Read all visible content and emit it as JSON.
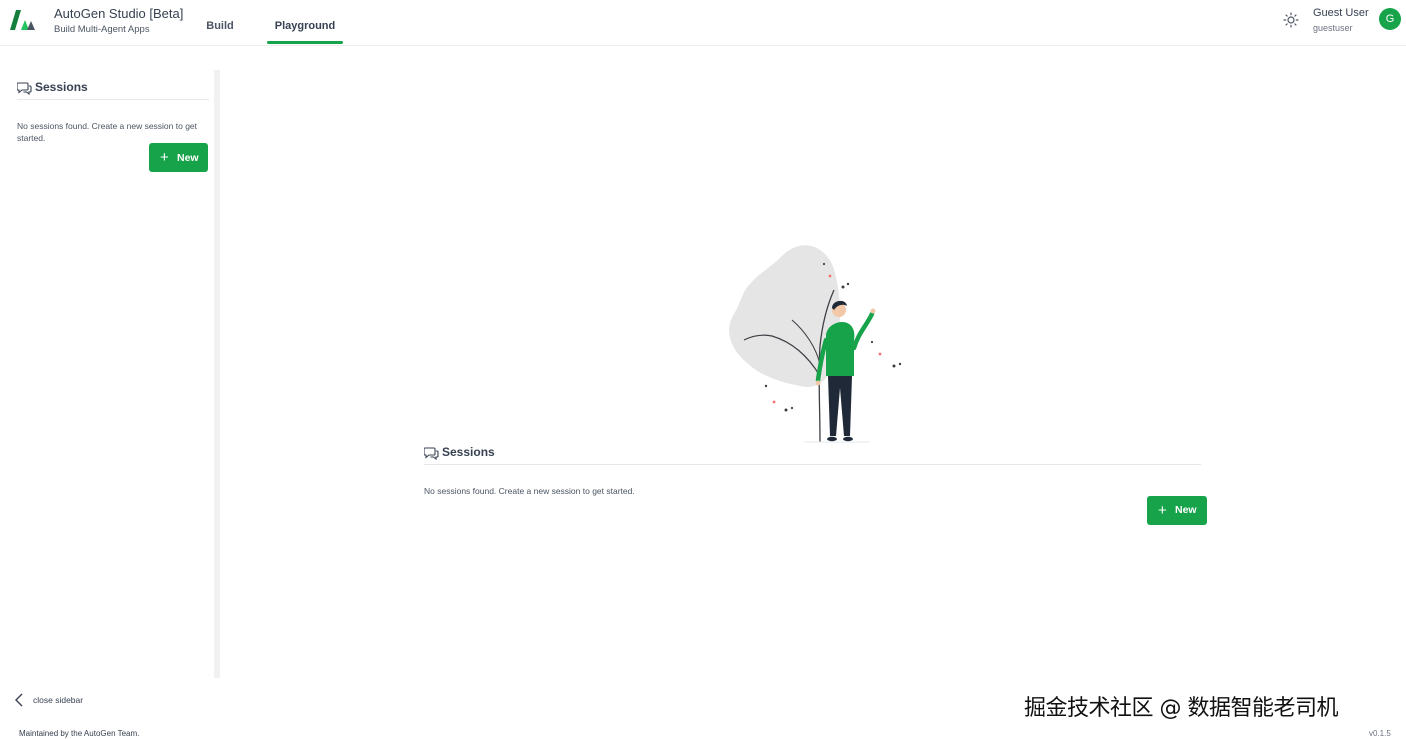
{
  "header": {
    "title": "AutoGen Studio [Beta]",
    "subtitle": "Build Multi-Agent Apps",
    "tabs": [
      {
        "label": "Build",
        "active": false
      },
      {
        "label": "Playground",
        "active": true
      }
    ],
    "theme_icon": "sun-icon",
    "user_name": "Guest User",
    "user_id": "guestuser",
    "avatar_letter": "G"
  },
  "sidebar": {
    "heading": "Sessions",
    "heading_icon": "chat-bubbles-icon",
    "empty_text": "No sessions found. Create a new session to get started.",
    "new_label": "New",
    "close_label": "close sidebar"
  },
  "main": {
    "heading": "Sessions",
    "empty_text": "No sessions found. Create a new session to get started.",
    "new_label": "New",
    "illustration": "person-waving-under-tree"
  },
  "footer": {
    "maintained": "Maintained by the AutoGen Team.",
    "version": "v0.1.5"
  },
  "watermark": "掘金技术社区 @ 数据智能老司机",
  "colors": {
    "accent": "#16a34a",
    "text": "#374151",
    "muted": "#6b7280",
    "divider": "#e5e7eb"
  }
}
